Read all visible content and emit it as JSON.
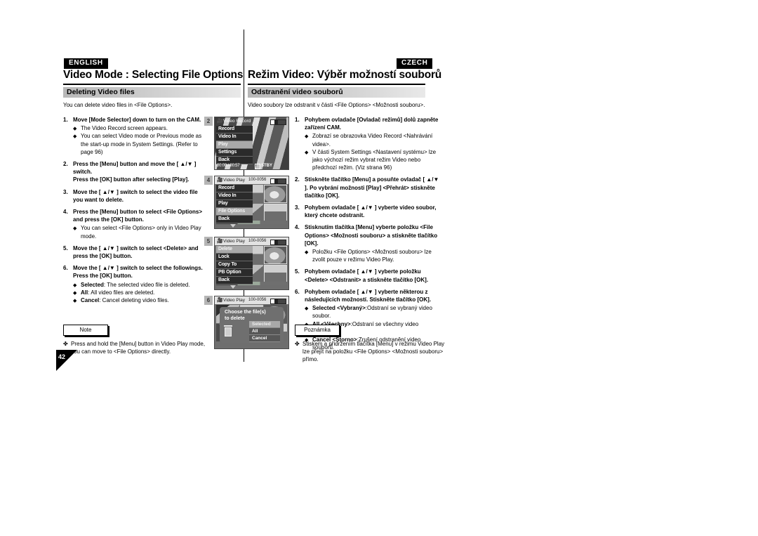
{
  "header": {
    "english_badge": "ENGLISH",
    "czech_badge": "CZECH",
    "english_title": "Video Mode : Selecting File Options",
    "czech_title": "Režim Video: Výběr možností souborů"
  },
  "english": {
    "section_title": "Deleting Video files",
    "intro": "You can delete video files in <File Options>.",
    "steps": [
      {
        "num": "1.",
        "text": "Move [Mode Selector] down to turn on the CAM.",
        "bullets": [
          "The Video Record screen appears.",
          "You can select Video mode or Previous mode as the start-up mode in System Settings. (Refer to page 96)"
        ]
      },
      {
        "num": "2.",
        "text": "Press the [Menu] button and move the [ ▲/▼ ] switch.",
        "text2": "Press the [OK] button after selecting [Play].",
        "bullets": []
      },
      {
        "num": "3.",
        "text": "Move the [ ▲/▼ ] switch to select the video file you want to delete.",
        "bullets": []
      },
      {
        "num": "4.",
        "text": "Press the [Menu] button to select <File Options> and press the [OK] button.",
        "bullets": [
          "You can select <File Options> only in Video Play mode."
        ]
      },
      {
        "num": "5.",
        "text": "Move the [ ▲/▼ ] switch to select <Delete> and press the [OK] button.",
        "bullets": []
      },
      {
        "num": "6.",
        "text": "Move the [ ▲/▼ ] switch to select the followings. Press the [OK] button.",
        "bullets_rich": [
          {
            "label": "Selected",
            "rest": ": The selected video file is deleted."
          },
          {
            "label": "All",
            "rest": ": All video files are deleted."
          },
          {
            "label": "Cancel",
            "rest": ": Cancel deleting video files."
          }
        ]
      }
    ],
    "note_label": "Note",
    "note_text": "Press and hold the [Menu] button in Video Play mode, you can move to <File Options> directly."
  },
  "czech": {
    "section_title": "Odstranění video souborů",
    "intro": "Video soubory lze odstranit v části <File Options> <Možnosti souboru>.",
    "steps": [
      {
        "num": "1.",
        "text": "Pohybem ovladače [Ovladač režimů] dolů zapněte zařízení CAM.",
        "bullets": [
          "Zobrazí se obrazovka Video Record <Nahrávání videa>.",
          "V části System Settings <Nastavení systému> lze jako výchozí režim vybrat režim Video nebo předchozí režim. (Viz strana 96)"
        ]
      },
      {
        "num": "2.",
        "text": "Stiskněte tlačítko [Menu] a posuňte ovladač [ ▲/▼ ]. Po vybrání možnosti [Play] <Přehrát> stiskněte tlačítko [OK].",
        "bullets": []
      },
      {
        "num": "3.",
        "text": "Pohybem ovladače [ ▲/▼ ] vyberte video soubor, který chcete odstranit.",
        "bullets": []
      },
      {
        "num": "4.",
        "text": "Stisknutím tlačítka [Menu] vyberte položku <File Options> <Možnosti souboru> a stiskněte tlačítko [OK].",
        "bullets": [
          "Položku <File Options> <Možnosti souboru> lze zvolit pouze v režimu Video Play."
        ]
      },
      {
        "num": "5.",
        "text": "Pohybem ovladače [ ▲/▼ ] vyberte položku <Delete> <Odstranit> a stiskněte tlačítko [OK].",
        "bullets": []
      },
      {
        "num": "6.",
        "text": "Pohybem ovladače [ ▲/▼ ] vyberte některou z následujících možností. Stiskněte tlačítko [OK].",
        "bullets_rich": [
          {
            "label": "Selected <Vybraný>",
            "rest": ":Odstraní se vybraný video soubor."
          },
          {
            "label": "All <Všechny>",
            "rest": ":Odstraní se všechny video soubory."
          },
          {
            "label": "Cancel <Storno>",
            "rest": ":Zrušení odstranění video souborů."
          }
        ]
      }
    ],
    "note_label": "Poznámka",
    "note_text": "Stiskem a přidržením tlačítka [Menu] v režimu Video Play lze přejít na položku <File Options> <Možnosti souboru> přímo."
  },
  "screens": [
    {
      "marker": "2",
      "title": "Video Record",
      "file": "",
      "menu": [
        {
          "label": "Record",
          "selected": false
        },
        {
          "label": "Video In",
          "selected": false
        },
        {
          "label": "Play",
          "selected": true
        },
        {
          "label": "Settings",
          "selected": false
        },
        {
          "label": "Back",
          "selected": false
        }
      ],
      "time": "00:00 / 00:57",
      "status": "STBY"
    },
    {
      "marker": "4",
      "title": "Video Play",
      "file": "100-0056",
      "menu": [
        {
          "label": "Record",
          "selected": false
        },
        {
          "label": "Video In",
          "selected": false
        },
        {
          "label": "Play",
          "selected": false
        },
        {
          "label": "File Options",
          "selected": true
        },
        {
          "label": "Back",
          "selected": false
        }
      ]
    },
    {
      "marker": "5",
      "title": "Video Play",
      "file": "100-0056",
      "menu": [
        {
          "label": "Delete",
          "selected": true
        },
        {
          "label": "Lock",
          "selected": false
        },
        {
          "label": "Copy To",
          "selected": false
        },
        {
          "label": "PB Option",
          "selected": false
        },
        {
          "label": "Back",
          "selected": false
        }
      ]
    },
    {
      "marker": "6",
      "title": "Video Play",
      "file": "100-0056",
      "dialog": {
        "line1": "Choose the file(s)",
        "line2": "to delete",
        "options": [
          {
            "label": "Selected",
            "selected": true
          },
          {
            "label": "All",
            "selected": false
          },
          {
            "label": "Cancel",
            "selected": false
          }
        ]
      }
    }
  ],
  "page_number": "42"
}
